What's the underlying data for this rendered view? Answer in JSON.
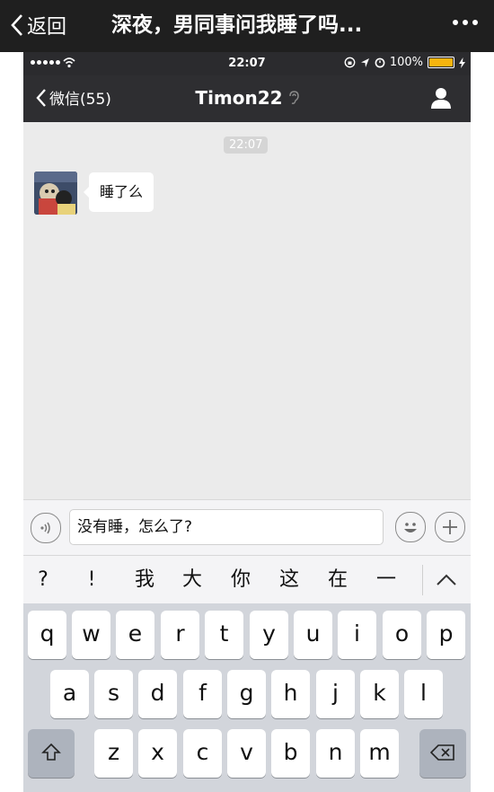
{
  "outer_header": {
    "back_label": "返回",
    "title": "深夜，男同事问我睡了吗..."
  },
  "status_bar": {
    "time": "22:07",
    "battery_text": "100%",
    "battery_level": 1.0,
    "battery_color": "#f6b40e"
  },
  "nav": {
    "back_label": "微信(55)",
    "title": "Timon22"
  },
  "chat": {
    "timestamp": "22:07",
    "messages": [
      {
        "text": "睡了么"
      }
    ]
  },
  "input": {
    "value": "没有睡，怎么了?"
  },
  "candidates": [
    "?",
    "!",
    "我",
    "大",
    "你",
    "这",
    "在",
    "一"
  ],
  "keyboard": {
    "row1": [
      "q",
      "w",
      "e",
      "r",
      "t",
      "y",
      "u",
      "i",
      "o",
      "p"
    ],
    "row2": [
      "a",
      "s",
      "d",
      "f",
      "g",
      "h",
      "j",
      "k",
      "l"
    ],
    "row3": [
      "z",
      "x",
      "c",
      "v",
      "b",
      "n",
      "m"
    ]
  },
  "colors": {
    "nav_background": "#2e2e31",
    "chat_background": "#ebebeb",
    "keyboard_background": "#d2d5db"
  }
}
